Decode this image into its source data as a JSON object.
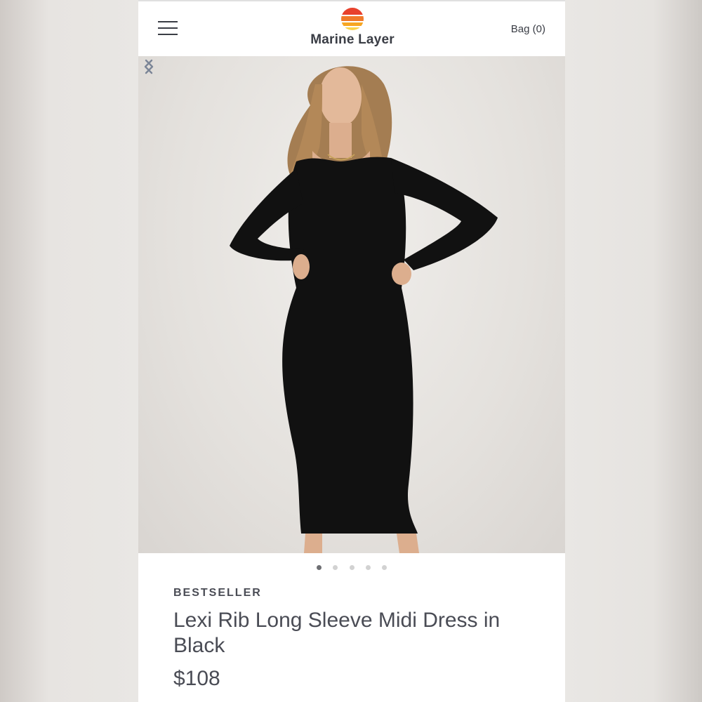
{
  "header": {
    "brand": "Marine Layer",
    "bag_label": "Bag (0)",
    "menu_icon": "hamburger-menu-icon",
    "logo_colors": [
      "#e8412c",
      "#f07a2a",
      "#f6a623",
      "#fbd24a"
    ]
  },
  "gallery": {
    "image": "woman-in-black-long-sleeve-midi-dress",
    "prev_icon": "chevron-left-icon",
    "next_icon": "chevron-right-icon",
    "slide_count": 5,
    "active_slide": 1
  },
  "product": {
    "badge": "BESTSELLER",
    "name": "Lexi Rib Long Sleeve Midi Dress in Black",
    "price": "$108"
  },
  "colors": {
    "text": "#4a4c55",
    "chevron": "#7b8597",
    "dress": "#111111"
  }
}
